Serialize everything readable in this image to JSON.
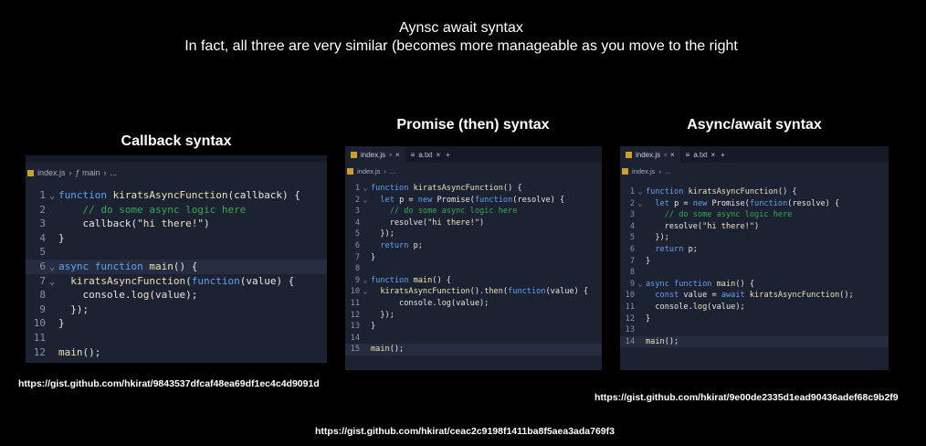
{
  "header": {
    "title": "Aynsc await syntax",
    "subtitle": "In fact, all three are very similar (becomes more manageable as you move to the right"
  },
  "colors": {
    "background": "#000000",
    "editor_bg": "#1d2233",
    "keyword": "#5ea3f0",
    "comment": "#33a852"
  },
  "panels": [
    {
      "heading": "Callback syntax",
      "url": "https://gist.github.com/hkirat/9843537dfcaf48ea69df1ec4c4d9091d",
      "tabs": [],
      "breadcrumb": [
        "index.js",
        "ƒ main",
        "..."
      ],
      "current_line": 6,
      "lines": [
        {
          "n": "1",
          "fold": true,
          "t": [
            [
              "k",
              "function "
            ],
            [
              "f",
              "kiratsAsyncFunction"
            ],
            [
              "p",
              "(callback) {"
            ]
          ]
        },
        {
          "n": "2",
          "t": [
            [
              "p",
              "    "
            ],
            [
              "c",
              "// do some async logic here"
            ]
          ]
        },
        {
          "n": "3",
          "t": [
            [
              "p",
              "    callback("
            ],
            [
              "s",
              "\"hi there!\""
            ],
            [
              "p",
              ")"
            ]
          ]
        },
        {
          "n": "4",
          "t": [
            [
              "p",
              "}"
            ]
          ]
        },
        {
          "n": "5",
          "t": []
        },
        {
          "n": "6",
          "fold": true,
          "t": [
            [
              "k",
              "async function "
            ],
            [
              "f",
              "main"
            ],
            [
              "p",
              "() {"
            ]
          ]
        },
        {
          "n": "7",
          "fold": true,
          "t": [
            [
              "p",
              "  "
            ],
            [
              "f",
              "kiratsAsyncFunction"
            ],
            [
              "p",
              "("
            ],
            [
              "k",
              "function"
            ],
            [
              "p",
              "(value) {"
            ]
          ]
        },
        {
          "n": "8",
          "t": [
            [
              "p",
              "    console."
            ],
            [
              "f",
              "log"
            ],
            [
              "p",
              "(value);"
            ]
          ]
        },
        {
          "n": "9",
          "t": [
            [
              "p",
              "  });"
            ]
          ]
        },
        {
          "n": "10",
          "t": [
            [
              "p",
              "}"
            ]
          ]
        },
        {
          "n": "11",
          "t": []
        },
        {
          "n": "12",
          "t": [
            [
              "f",
              "main"
            ],
            [
              "p",
              "();"
            ]
          ]
        }
      ]
    },
    {
      "heading": "Promise (then) syntax",
      "url": "https://gist.github.com/hkirat/ceac2c9198f1411ba8f5aea3ada769f3",
      "tabs": [
        "index.js",
        "a.txt"
      ],
      "breadcrumb": [
        "index.js",
        "..."
      ],
      "current_line": 15,
      "lines": [
        {
          "n": "1",
          "fold": true,
          "t": [
            [
              "k",
              "function "
            ],
            [
              "f",
              "kiratsAsyncFunction"
            ],
            [
              "p",
              "() {"
            ]
          ]
        },
        {
          "n": "2",
          "fold": true,
          "t": [
            [
              "p",
              "  "
            ],
            [
              "k",
              "let "
            ],
            [
              "p",
              "p = "
            ],
            [
              "k",
              "new "
            ],
            [
              "p",
              "Promise("
            ],
            [
              "k",
              "function"
            ],
            [
              "p",
              "(resolve) {"
            ]
          ]
        },
        {
          "n": "3",
          "t": [
            [
              "p",
              "    "
            ],
            [
              "c",
              "// do some async logic here"
            ]
          ]
        },
        {
          "n": "4",
          "t": [
            [
              "p",
              "    resolve("
            ],
            [
              "s",
              "\"hi there!\""
            ],
            [
              "p",
              ")"
            ]
          ]
        },
        {
          "n": "5",
          "t": [
            [
              "p",
              "  });"
            ]
          ]
        },
        {
          "n": "6",
          "t": [
            [
              "p",
              "  "
            ],
            [
              "k",
              "return "
            ],
            [
              "p",
              "p;"
            ]
          ]
        },
        {
          "n": "7",
          "t": [
            [
              "p",
              "}"
            ]
          ]
        },
        {
          "n": "8",
          "t": []
        },
        {
          "n": "9",
          "fold": true,
          "t": [
            [
              "k",
              "function "
            ],
            [
              "f",
              "main"
            ],
            [
              "p",
              "() {"
            ]
          ]
        },
        {
          "n": "10",
          "fold": true,
          "t": [
            [
              "p",
              "  "
            ],
            [
              "f",
              "kiratsAsyncFunction"
            ],
            [
              "p",
              "()."
            ],
            [
              "f",
              "then"
            ],
            [
              "p",
              "("
            ],
            [
              "k",
              "function"
            ],
            [
              "p",
              "(value) {"
            ]
          ]
        },
        {
          "n": "11",
          "t": [
            [
              "p",
              "      console."
            ],
            [
              "f",
              "log"
            ],
            [
              "p",
              "(value);"
            ]
          ]
        },
        {
          "n": "12",
          "t": [
            [
              "p",
              "  });"
            ]
          ]
        },
        {
          "n": "13",
          "t": [
            [
              "p",
              "}"
            ]
          ]
        },
        {
          "n": "14",
          "t": []
        },
        {
          "n": "15",
          "t": [
            [
              "f",
              "main"
            ],
            [
              "p",
              "();"
            ]
          ]
        }
      ]
    },
    {
      "heading": "Async/await syntax",
      "url": "https://gist.github.com/hkirat/9e00de2335d1ead90436adef68c9b2f9",
      "tabs": [
        "index.js",
        "a.txt"
      ],
      "breadcrumb": [
        "index.js",
        "..."
      ],
      "current_line": 14,
      "lines": [
        {
          "n": "1",
          "fold": true,
          "t": [
            [
              "k",
              "function "
            ],
            [
              "f",
              "kiratsAsyncFunction"
            ],
            [
              "p",
              "() {"
            ]
          ]
        },
        {
          "n": "2",
          "fold": true,
          "t": [
            [
              "p",
              "  "
            ],
            [
              "k",
              "let "
            ],
            [
              "p",
              "p = "
            ],
            [
              "k",
              "new "
            ],
            [
              "p",
              "Promise("
            ],
            [
              "k",
              "function"
            ],
            [
              "p",
              "(resolve) {"
            ]
          ]
        },
        {
          "n": "3",
          "t": [
            [
              "p",
              "    "
            ],
            [
              "c",
              "// do some async logic here"
            ]
          ]
        },
        {
          "n": "4",
          "t": [
            [
              "p",
              "    resolve("
            ],
            [
              "s",
              "\"hi there!\""
            ],
            [
              "p",
              ")"
            ]
          ]
        },
        {
          "n": "5",
          "t": [
            [
              "p",
              "  });"
            ]
          ]
        },
        {
          "n": "6",
          "t": [
            [
              "p",
              "  "
            ],
            [
              "k",
              "return "
            ],
            [
              "p",
              "p;"
            ]
          ]
        },
        {
          "n": "7",
          "t": [
            [
              "p",
              "}"
            ]
          ]
        },
        {
          "n": "8",
          "t": []
        },
        {
          "n": "9",
          "fold": true,
          "t": [
            [
              "k",
              "async function "
            ],
            [
              "f",
              "main"
            ],
            [
              "p",
              "() {"
            ]
          ]
        },
        {
          "n": "10",
          "t": [
            [
              "p",
              "  "
            ],
            [
              "k",
              "const "
            ],
            [
              "p",
              "value = "
            ],
            [
              "k",
              "await "
            ],
            [
              "f",
              "kiratsAsyncFunction"
            ],
            [
              "p",
              "();"
            ]
          ]
        },
        {
          "n": "11",
          "t": [
            [
              "p",
              "  console."
            ],
            [
              "f",
              "log"
            ],
            [
              "p",
              "(value);"
            ]
          ]
        },
        {
          "n": "12",
          "t": [
            [
              "p",
              "}"
            ]
          ]
        },
        {
          "n": "13",
          "t": []
        },
        {
          "n": "14",
          "t": [
            [
              "f",
              "main"
            ],
            [
              "p",
              "();"
            ]
          ]
        }
      ]
    }
  ]
}
